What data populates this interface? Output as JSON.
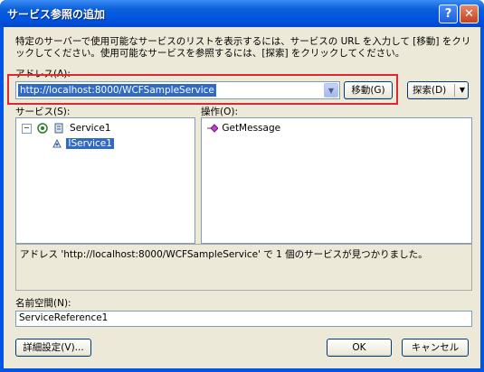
{
  "window": {
    "title": "サービス参照の追加",
    "help_label": "?",
    "close_label": "✕"
  },
  "description": "特定のサーバーで使用可能なサービスのリストを表示するには、サービスの URL を入力して [移動] をクリックしてください。使用可能なサービスを参照するには、[探索] をクリックしてください。",
  "address": {
    "label": "アドレス(A):",
    "value": "http://localhost:8000/WCFSampleService",
    "go_button": "移動(G)",
    "discover_button": "探索(D)",
    "dropdown_glyph": "▼"
  },
  "services": {
    "label": "サービス(S):",
    "tree": [
      {
        "expander": "⊟",
        "label": "Service1",
        "icon": "service-icon"
      },
      {
        "label": "IService1",
        "icon": "contract-icon",
        "selected": true
      }
    ]
  },
  "operations": {
    "label": "操作(O):",
    "items": [
      {
        "label": "GetMessage",
        "icon": "method-icon"
      }
    ]
  },
  "status_message": "アドレス 'http://localhost:8000/WCFSampleService' で 1 個のサービスが見つかりました。",
  "namespace": {
    "label": "名前空間(N):",
    "value": "ServiceReference1"
  },
  "buttons": {
    "advanced": "詳細設定(V)...",
    "ok": "OK",
    "cancel": "キャンセル"
  },
  "colors": {
    "title_bar": "#0054e3",
    "dialog_bg": "#ece9d8",
    "selection": "#316ac5",
    "highlight_border": "#e0262e"
  }
}
